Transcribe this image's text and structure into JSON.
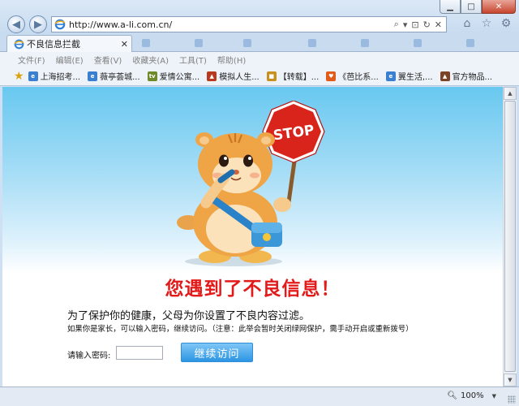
{
  "browser": {
    "url": "http://www.a-li.com.cn/",
    "window_buttons": {
      "minimize": "▁",
      "maximize": "□",
      "close": "✕"
    },
    "tab": {
      "label": "不良信息拦截",
      "close": "✕"
    },
    "menu": [
      "文件(F)",
      "编辑(E)",
      "查看(V)",
      "收藏夹(A)",
      "工具(T)",
      "帮助(H)"
    ],
    "favorites": [
      {
        "label": "上海招考...",
        "icon": "ie-icon",
        "color": "#3a7fd0"
      },
      {
        "label": "薇亭荟城...",
        "icon": "ie-icon",
        "color": "#3a7fd0"
      },
      {
        "label": "爱情公寓...",
        "icon": "tv-icon",
        "color": "#6e8a2a"
      },
      {
        "label": "模拟人生...",
        "icon": "game-icon",
        "color": "#b83a1e"
      },
      {
        "label": "【转载】...",
        "icon": "block-icon",
        "color": "#c8901d"
      },
      {
        "label": "《芭比系...",
        "icon": "heart-icon",
        "color": "#e15a1a"
      },
      {
        "label": "翼生活,...",
        "icon": "ie-icon",
        "color": "#3a7fd0"
      },
      {
        "label": "官方物品...",
        "icon": "game-icon",
        "color": "#7b4426"
      }
    ],
    "zoom": "100%"
  },
  "page": {
    "sign_text": "STOP",
    "title": "您遇到了不良信息！",
    "line1": "为了保护你的健康，父母为你设置了不良内容过滤。",
    "line2": "如果你是家长，可以输入密码，继续访问。（注意：此举会暂时关闭绿网保护，需手动开启或重新拨号）",
    "password_label": "请输入密码:",
    "password_value": "",
    "continue_label": "继续访问"
  },
  "colors": {
    "title_red": "#e21a1a",
    "button_blue": "#2c95e3",
    "sky_blue": "#68c8f0",
    "stop_red": "#d9241c"
  }
}
